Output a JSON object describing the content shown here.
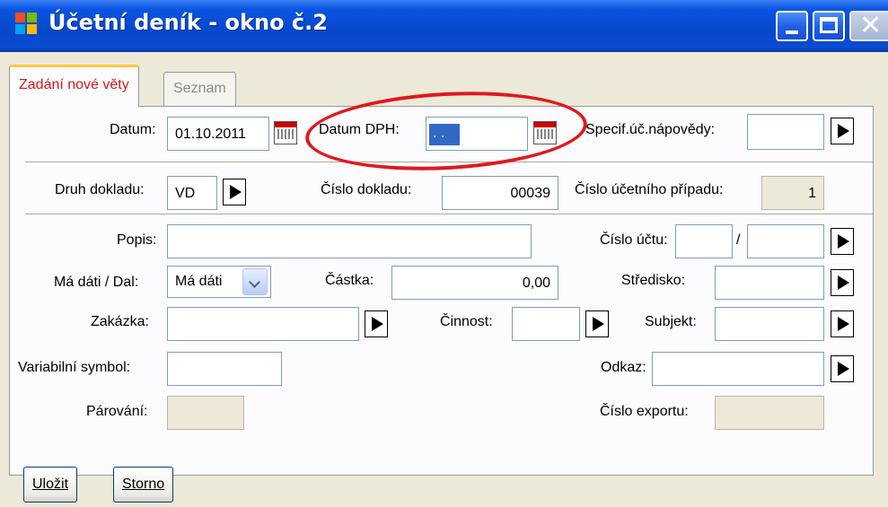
{
  "window": {
    "title": "Účetní deník - okno č.2"
  },
  "tabs": [
    {
      "label": "Zadání nové věty"
    },
    {
      "label": "Seznam"
    }
  ],
  "form": {
    "datum_label": "Datum:",
    "datum_value": "01.10.2011",
    "datum_dph_label": "Datum DPH:",
    "datum_dph_value": ". .",
    "specif_label": "Specif.úč.nápovědy:",
    "specif_value": "",
    "druh_label": "Druh dokladu:",
    "druh_value": "VD",
    "cislo_dokladu_label": "Číslo dokladu:",
    "cislo_dokladu_value": "00039",
    "cislo_pripadu_label": "Číslo účetního případu:",
    "cislo_pripadu_value": "1",
    "popis_label": "Popis:",
    "popis_value": "",
    "cislo_uctu_label": "Číslo účtu:",
    "cislo_uctu_value1": "",
    "cislo_uctu_sep": "/",
    "cislo_uctu_value2": "",
    "ma_dati_label": "Má dáti / Dal:",
    "ma_dati_value": "Má dáti",
    "castka_label": "Částka:",
    "castka_value": "0,00",
    "stredisko_label": "Středisko:",
    "stredisko_value": "",
    "zakazka_label": "Zakázka:",
    "zakazka_value": "",
    "cinnost_label": "Činnost:",
    "cinnost_value": "",
    "subjekt_label": "Subjekt:",
    "subjekt_value": "",
    "variabilni_label": "Variabilní symbol:",
    "variabilni_value": "",
    "odkaz_label": "Odkaz:",
    "odkaz_value": "",
    "parovani_label": "Párování:",
    "parovani_value": "",
    "cislo_exportu_label": "Číslo exportu:",
    "cislo_exportu_value": ""
  },
  "buttons": {
    "save_label": "Uložit",
    "cancel_label": "Storno"
  },
  "colors": {
    "title_bar": "#0A55E3",
    "active_tab_text": "#D0191D",
    "highlight_ellipse": "#E0191D",
    "window_bg": "#ECE9D8"
  },
  "icons": [
    "app-icon",
    "minimize-icon",
    "maximize-icon",
    "close-icon",
    "calendar-icon",
    "arrow-right-icon",
    "chevron-down-icon"
  ]
}
